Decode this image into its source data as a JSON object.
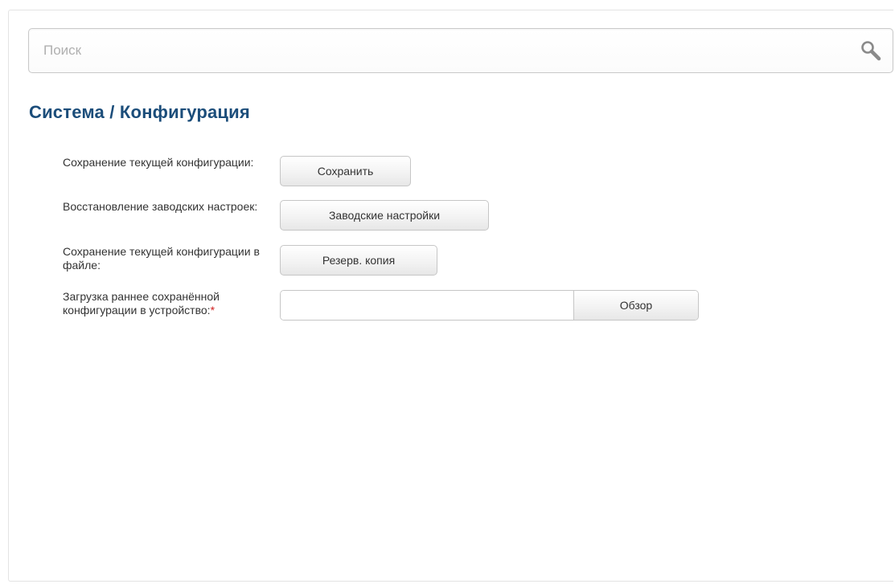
{
  "search": {
    "placeholder": "Поиск",
    "value": "",
    "icon": "search-icon"
  },
  "page": {
    "title": "Система /  Конфигурация"
  },
  "config": {
    "save": {
      "label": "Сохранение текущей конфигурации:",
      "button": "Сохранить"
    },
    "factory_reset": {
      "label": "Восстановление заводских настроек:",
      "button": "Заводские настройки"
    },
    "backup": {
      "label": "Сохранение текущей конфигурации в файле:",
      "button": "Резерв. копия"
    },
    "upload": {
      "label": "Загрузка раннее сохранённой конфигурации в устройство:",
      "required_mark": "*",
      "file_value": "",
      "browse_button": "Обзор"
    }
  },
  "colors": {
    "title": "#1b4d7a",
    "required": "#d02020",
    "border": "#c6c6c6"
  }
}
